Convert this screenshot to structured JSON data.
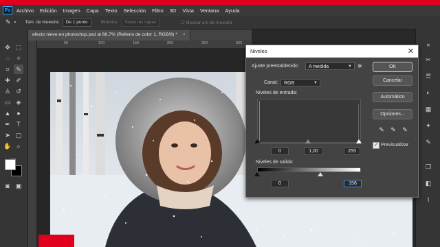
{
  "app": {
    "logo": "Ps"
  },
  "menu": [
    "Archivo",
    "Edición",
    "Imagen",
    "Capa",
    "Texto",
    "Selección",
    "Filtro",
    "3D",
    "Vista",
    "Ventana",
    "Ayuda"
  ],
  "options": {
    "sample_size_label": "Tam. de muestra:",
    "sample_size_value": "De 1 punto",
    "sample_label": "Muestra:",
    "sample_value": "Todas las capas",
    "show_ring": "Mostrar aro de muestra"
  },
  "document": {
    "tab_title": "efecto nieve en photoshop.psd al 66,7% (Relleno de color 1, RGB/8) *",
    "close": "×"
  },
  "ruler": {
    "ticks": [
      "50",
      "100",
      "150",
      "200",
      "250",
      "300"
    ]
  },
  "dialog": {
    "title": "Niveles",
    "close": "✕",
    "preset_label": "Ajuste preestablecido:",
    "preset_value": "A medida",
    "channel_label": "Canal:",
    "channel_value": "RGB",
    "input_label": "Niveles de entrada:",
    "input_black": "0",
    "input_mid": "1,00",
    "input_white": "255",
    "output_label": "Niveles de salida:",
    "output_black": "0",
    "output_white": "158",
    "buttons": {
      "ok": "OK",
      "cancel": "Cancelar",
      "auto": "Automático",
      "options": "Opciones..."
    },
    "preview_label": "Previsualizar",
    "preview_checked": true
  },
  "colors": {
    "accent_red": "#e0001e",
    "dialog_bg": "#434343",
    "focus": "#3c8ee6"
  }
}
